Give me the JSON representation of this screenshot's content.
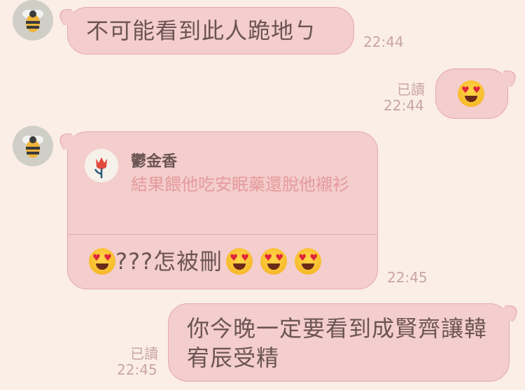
{
  "messages": [
    {
      "text": "不可能看到此人跪地ㄅ",
      "time": "22:44"
    },
    {
      "read": "已讀",
      "time": "22:44"
    },
    {
      "quote": {
        "name": "鬱金香",
        "text": "結果餵他吃安眠藥還脫他襯衫"
      },
      "text": "???怎被刪",
      "time": "22:45"
    },
    {
      "text": "你今晚一定要看到成賢齊讓韓宥辰受精",
      "read": "已讀",
      "time": "22:45"
    }
  ],
  "icons": {
    "avatar": "bee-icon",
    "quote_avatar": "tulip-icon",
    "emoji": "heart-eyes-emoji"
  },
  "colors": {
    "background": "#fbeee6",
    "bubble": "#f4cdcd",
    "bubble_border": "#e4a9ab",
    "text": "#6b5553",
    "meta": "#c8a4a6",
    "quote_text": "#e59a9c"
  }
}
